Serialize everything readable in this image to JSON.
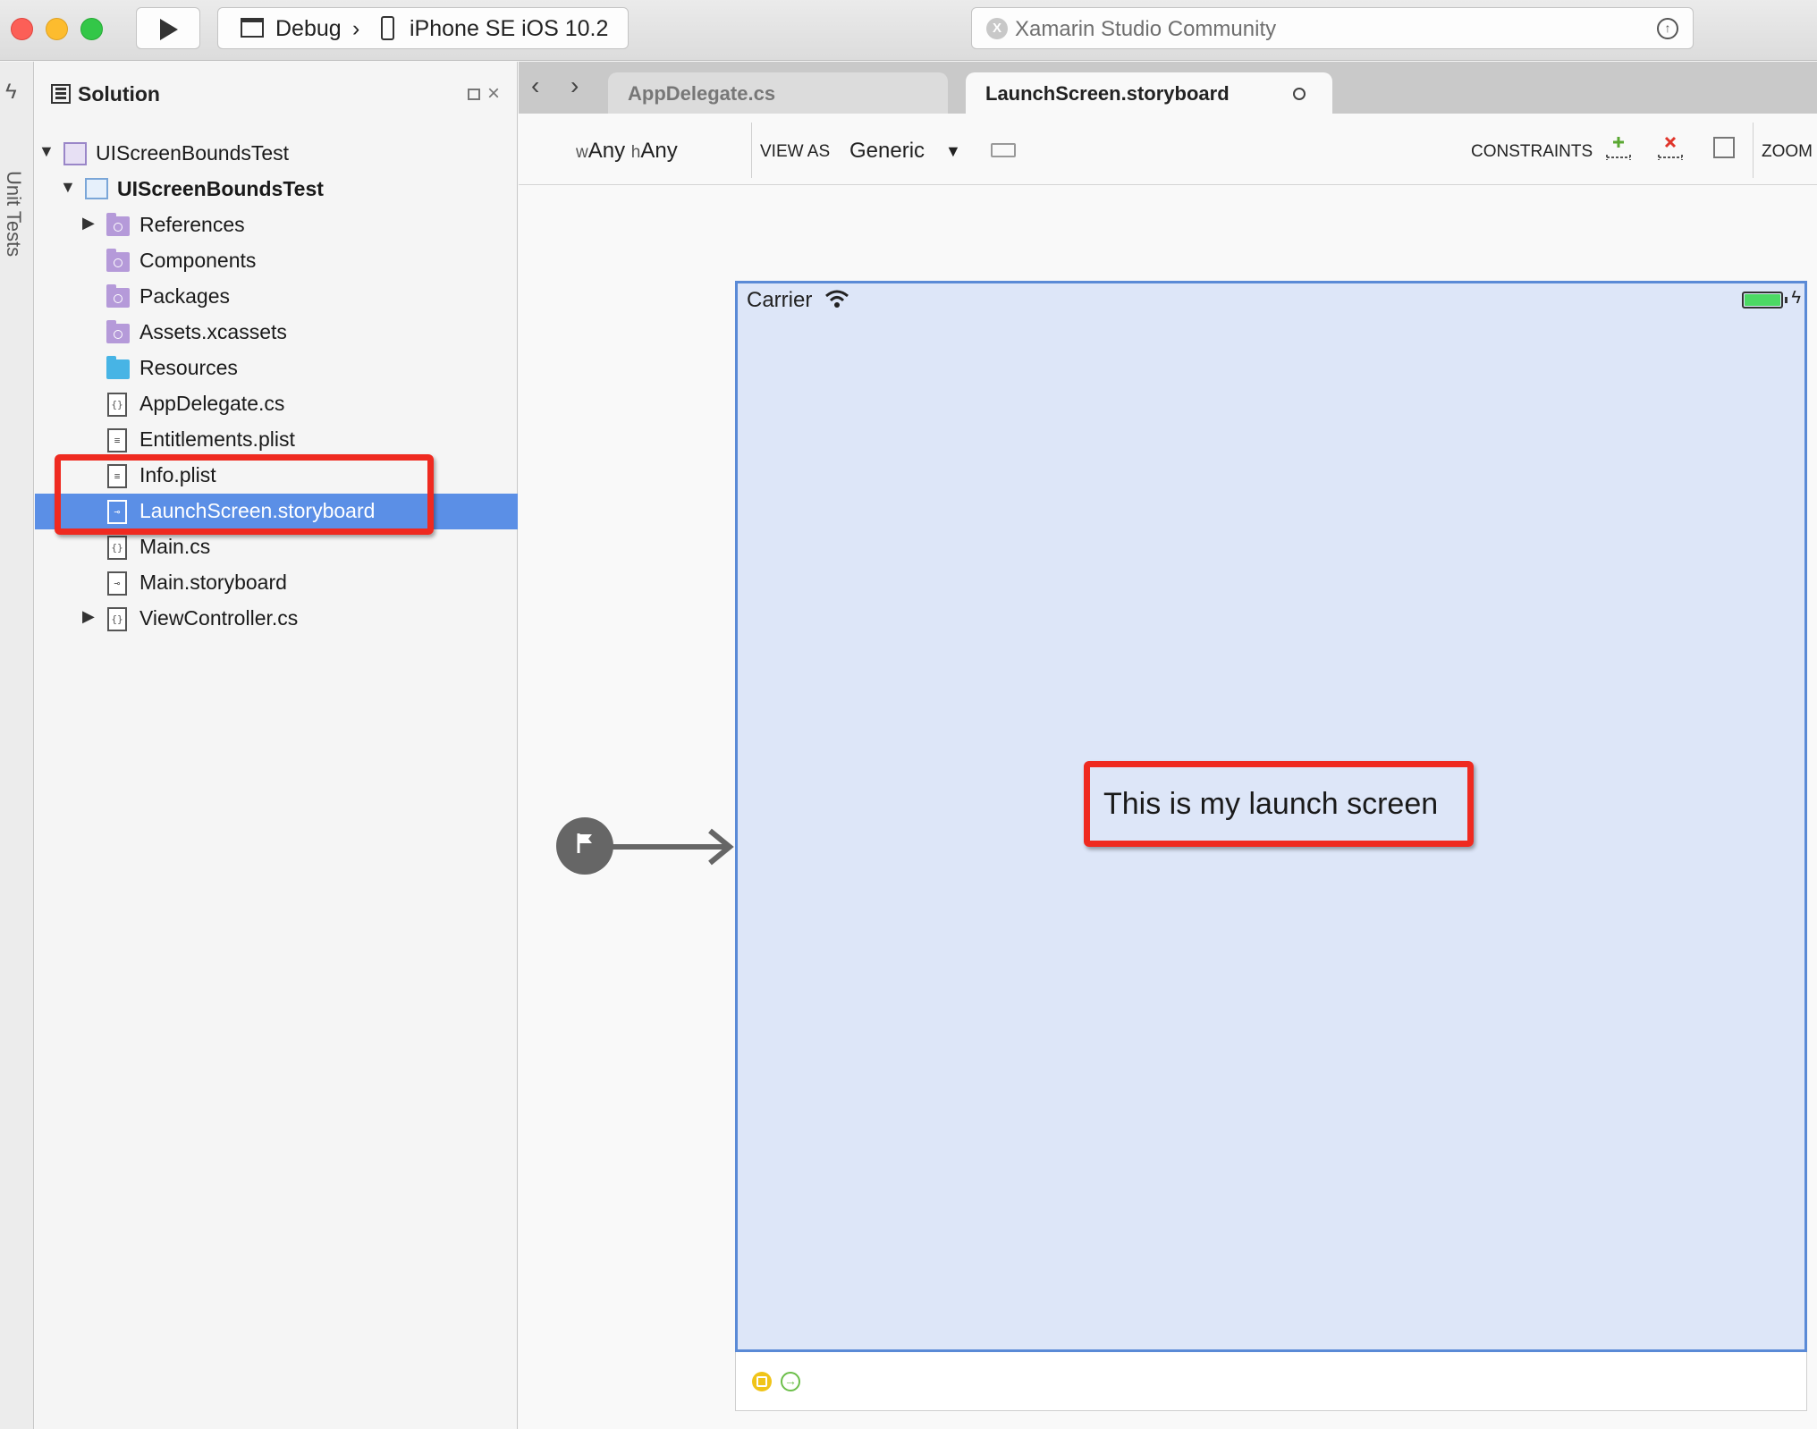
{
  "toolbar": {
    "configuration": "Debug",
    "separator": "›",
    "device": "iPhone SE iOS 10.2",
    "status": "Xamarin Studio Community"
  },
  "side_strip": {
    "label": "Unit Tests"
  },
  "solution_pad": {
    "title": "Solution",
    "tree": [
      {
        "label": "UIScreenBoundsTest",
        "icon": "solution-icon"
      },
      {
        "label": "UIScreenBoundsTest",
        "icon": "project-icon"
      },
      {
        "label": "References",
        "icon": "folder-icon"
      },
      {
        "label": "Components",
        "icon": "folder-icon"
      },
      {
        "label": "Packages",
        "icon": "folder-icon"
      },
      {
        "label": "Assets.xcassets",
        "icon": "folder-icon"
      },
      {
        "label": "Resources",
        "icon": "folder-icon"
      },
      {
        "label": "AppDelegate.cs",
        "icon": "code-file-icon"
      },
      {
        "label": "Entitlements.plist",
        "icon": "plist-file-icon"
      },
      {
        "label": "Info.plist",
        "icon": "plist-file-icon"
      },
      {
        "label": "LaunchScreen.storyboard",
        "icon": "storyboard-file-icon",
        "selected": true
      },
      {
        "label": "Main.cs",
        "icon": "code-file-icon"
      },
      {
        "label": "Main.storyboard",
        "icon": "storyboard-file-icon"
      },
      {
        "label": "ViewController.cs",
        "icon": "code-file-icon"
      }
    ]
  },
  "tabs": [
    {
      "label": "AppDelegate.cs",
      "active": false
    },
    {
      "label": "LaunchScreen.storyboard",
      "active": true
    }
  ],
  "design_toolbar": {
    "size_w_prefix": "w",
    "size_w": "Any",
    "size_h_prefix": "h",
    "size_h": "Any",
    "view_as_label": "VIEW AS",
    "view_as_value": "Generic",
    "constraints_label": "CONSTRAINTS",
    "zoom_label": "ZOOM"
  },
  "scene": {
    "carrier": "Carrier",
    "launch_text": "This is my launch screen"
  },
  "colors": {
    "highlight": "#ef2a20",
    "selection": "#5b8fe6",
    "scene_background": "#dde6f8",
    "scene_border": "#5a8ad6"
  }
}
